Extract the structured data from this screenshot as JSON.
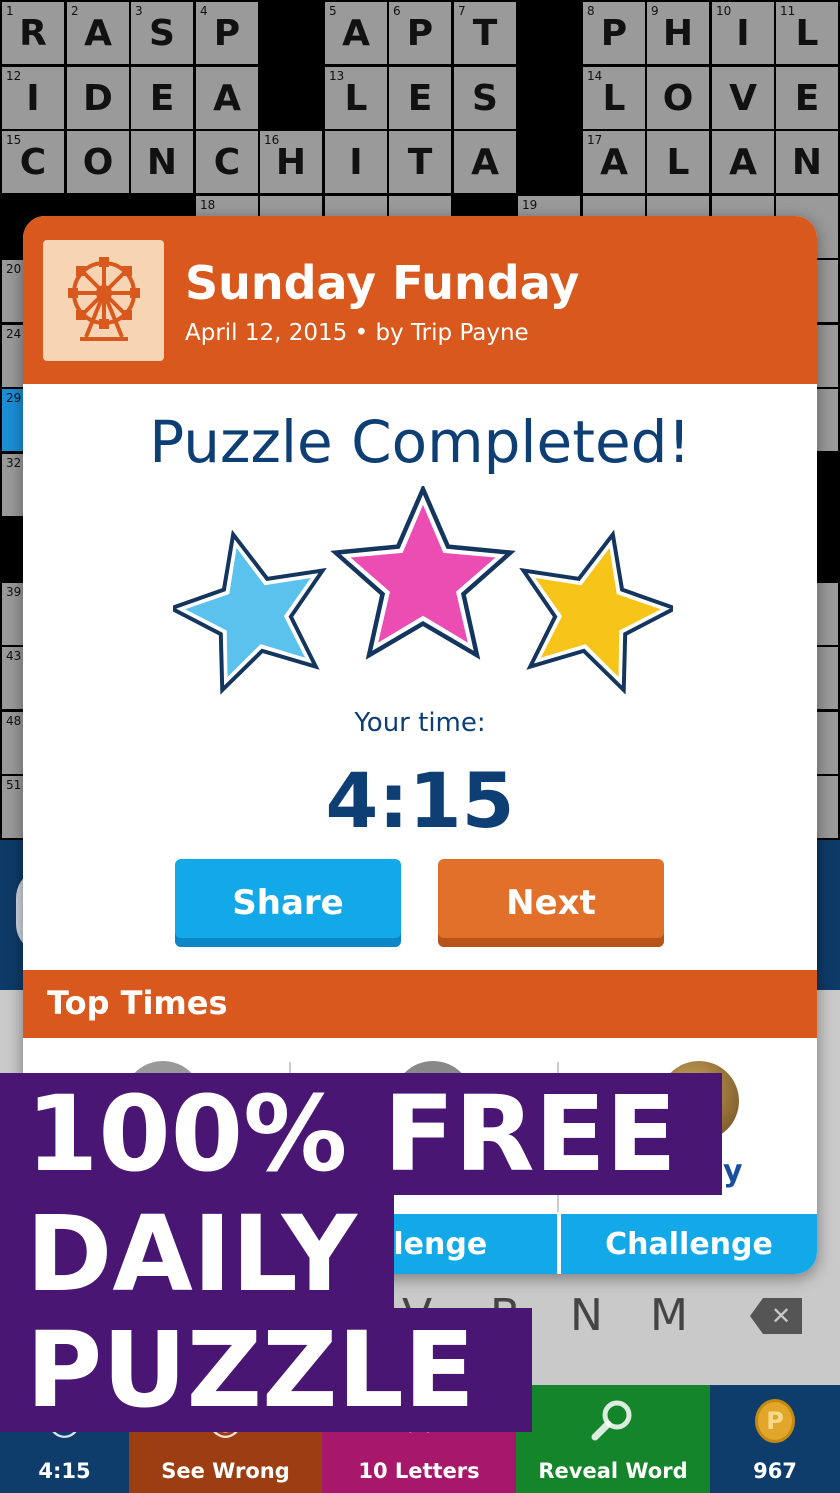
{
  "grid": {
    "cells": [
      {
        "c": 0,
        "r": 0,
        "l": "R",
        "n": "1"
      },
      {
        "c": 1,
        "r": 0,
        "l": "A",
        "n": "2"
      },
      {
        "c": 2,
        "r": 0,
        "l": "S",
        "n": "3"
      },
      {
        "c": 3,
        "r": 0,
        "l": "P",
        "n": "4"
      },
      {
        "c": 5,
        "r": 0,
        "l": "A",
        "n": "5"
      },
      {
        "c": 6,
        "r": 0,
        "l": "P",
        "n": "6"
      },
      {
        "c": 7,
        "r": 0,
        "l": "T",
        "n": "7"
      },
      {
        "c": 9,
        "r": 0,
        "l": "P",
        "n": "8"
      },
      {
        "c": 10,
        "r": 0,
        "l": "H",
        "n": "9"
      },
      {
        "c": 11,
        "r": 0,
        "l": "I",
        "n": "10"
      },
      {
        "c": 12,
        "r": 0,
        "l": "L",
        "n": "11"
      },
      {
        "c": 0,
        "r": 1,
        "l": "I",
        "n": "12"
      },
      {
        "c": 1,
        "r": 1,
        "l": "D",
        "n": ""
      },
      {
        "c": 2,
        "r": 1,
        "l": "E",
        "n": ""
      },
      {
        "c": 3,
        "r": 1,
        "l": "A",
        "n": ""
      },
      {
        "c": 5,
        "r": 1,
        "l": "L",
        "n": "13"
      },
      {
        "c": 6,
        "r": 1,
        "l": "E",
        "n": ""
      },
      {
        "c": 7,
        "r": 1,
        "l": "S",
        "n": ""
      },
      {
        "c": 9,
        "r": 1,
        "l": "L",
        "n": "14"
      },
      {
        "c": 10,
        "r": 1,
        "l": "O",
        "n": ""
      },
      {
        "c": 11,
        "r": 1,
        "l": "V",
        "n": ""
      },
      {
        "c": 12,
        "r": 1,
        "l": "E",
        "n": ""
      },
      {
        "c": 0,
        "r": 2,
        "l": "C",
        "n": "15"
      },
      {
        "c": 1,
        "r": 2,
        "l": "O",
        "n": ""
      },
      {
        "c": 2,
        "r": 2,
        "l": "N",
        "n": ""
      },
      {
        "c": 3,
        "r": 2,
        "l": "C",
        "n": ""
      },
      {
        "c": 4,
        "r": 2,
        "l": "H",
        "n": "16"
      },
      {
        "c": 5,
        "r": 2,
        "l": "I",
        "n": ""
      },
      {
        "c": 6,
        "r": 2,
        "l": "T",
        "n": ""
      },
      {
        "c": 7,
        "r": 2,
        "l": "A",
        "n": ""
      },
      {
        "c": 9,
        "r": 2,
        "l": "A",
        "n": "17"
      },
      {
        "c": 10,
        "r": 2,
        "l": "L",
        "n": ""
      },
      {
        "c": 11,
        "r": 2,
        "l": "A",
        "n": ""
      },
      {
        "c": 12,
        "r": 2,
        "l": "N",
        "n": ""
      },
      {
        "c": 3,
        "r": 3,
        "l": "",
        "n": "18"
      },
      {
        "c": 4,
        "r": 3,
        "l": "",
        "n": ""
      },
      {
        "c": 5,
        "r": 3,
        "l": "",
        "n": ""
      },
      {
        "c": 6,
        "r": 3,
        "l": "",
        "n": ""
      },
      {
        "c": 8,
        "r": 3,
        "l": "",
        "n": "19"
      },
      {
        "c": 9,
        "r": 3,
        "l": "",
        "n": ""
      },
      {
        "c": 10,
        "r": 3,
        "l": "",
        "n": ""
      },
      {
        "c": 11,
        "r": 3,
        "l": "",
        "n": ""
      },
      {
        "c": 12,
        "r": 3,
        "l": "",
        "n": ""
      },
      {
        "c": 0,
        "r": 4,
        "l": "",
        "n": "20"
      },
      {
        "c": 12,
        "r": 4,
        "l": "",
        "n": ""
      },
      {
        "c": 0,
        "r": 5,
        "l": "",
        "n": "24"
      },
      {
        "c": 12,
        "r": 5,
        "l": "",
        "n": ""
      },
      {
        "c": 0,
        "r": 6,
        "l": "",
        "n": "29",
        "s": true
      },
      {
        "c": 12,
        "r": 6,
        "l": "",
        "n": ""
      },
      {
        "c": 0,
        "r": 7,
        "l": "",
        "n": "32"
      },
      {
        "c": 0,
        "r": 9,
        "l": "",
        "n": "39"
      },
      {
        "c": 12,
        "r": 9,
        "l": "",
        "n": ""
      },
      {
        "c": 0,
        "r": 10,
        "l": "",
        "n": "43"
      },
      {
        "c": 12,
        "r": 10,
        "l": "",
        "n": ""
      },
      {
        "c": 0,
        "r": 11,
        "l": "",
        "n": "48"
      },
      {
        "c": 12,
        "r": 11,
        "l": "",
        "n": ""
      },
      {
        "c": 0,
        "r": 12,
        "l": "",
        "n": "51"
      },
      {
        "c": 12,
        "r": 12,
        "l": "",
        "n": ""
      }
    ]
  },
  "keyboard": {
    "keys": [
      "V",
      "B",
      "N",
      "M"
    ],
    "backspace_glyph": "✕"
  },
  "toolbar": {
    "timer": "4:15",
    "see_wrong": "See Wrong",
    "letters": "10 Letters",
    "reveal_word": "Reveal Word",
    "coins": "967",
    "coin_glyph": "P"
  },
  "dialog": {
    "puzzle_title": "Sunday Funday",
    "puzzle_meta": "April 12, 2015 • by Trip Payne",
    "icon": "ferris-wheel-icon",
    "heading": "Puzzle Completed!",
    "stars_earned": 3,
    "stars_total": 3,
    "star_colors": [
      "#5bc2ee",
      "#ec4db3",
      "#f7c51a"
    ],
    "time_label": "Your time:",
    "time_value": "4:15",
    "share_label": "Share",
    "next_label": "Next",
    "top_times_label": "Top Times",
    "leader_3_name_tail": "y",
    "challenge_2_label": "allenge",
    "challenge_3_label": "Challenge"
  },
  "promo": {
    "line1": "100% FREE",
    "line2": "DAILY",
    "line3": "PUZZLE"
  },
  "colors": {
    "brand_orange": "#d8581d",
    "navy": "#0d3f75",
    "share_blue": "#13a9e8",
    "promo_purple": "#4a1673"
  }
}
